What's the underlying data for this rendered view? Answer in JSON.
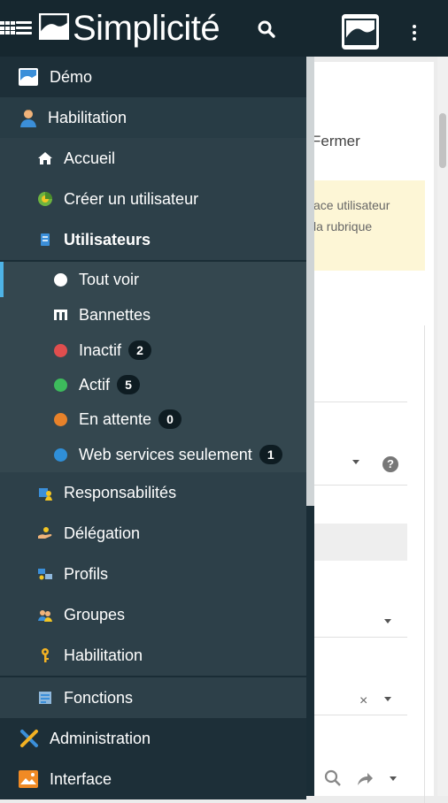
{
  "app": {
    "brand": "Simplicité"
  },
  "background": {
    "fermer": "Fermer",
    "notice_line1": "ace utilisateur",
    "notice_line2": "la rubrique",
    "clear_symbol": "×"
  },
  "menu": {
    "demo": "Démo",
    "habilitation_group": "Habilitation",
    "accueil": "Accueil",
    "creer": "Créer un utilisateur",
    "utilisateurs": "Utilisateurs",
    "tout_voir": "Tout voir",
    "bannettes": "Bannettes",
    "inactif": {
      "label": "Inactif",
      "count": "2",
      "color": "#e04e4e"
    },
    "actif": {
      "label": "Actif",
      "count": "5",
      "color": "#3dbb5c"
    },
    "attente": {
      "label": "En attente",
      "count": "0",
      "color": "#e8822a"
    },
    "webservices": {
      "label": "Web services seulement",
      "count": "1",
      "color": "#2f8fd8"
    },
    "responsabilites": "Responsabilités",
    "delegation": "Délégation",
    "profils": "Profils",
    "groupes": "Groupes",
    "habilitation_item": "Habilitation",
    "fonctions": "Fonctions",
    "administration": "Administration",
    "interface": "Interface"
  },
  "icons": {
    "menu": "hamburger-icon",
    "search": "search-icon",
    "apps": "grid-icon",
    "user": "avatar",
    "more": "kebab-icon"
  }
}
